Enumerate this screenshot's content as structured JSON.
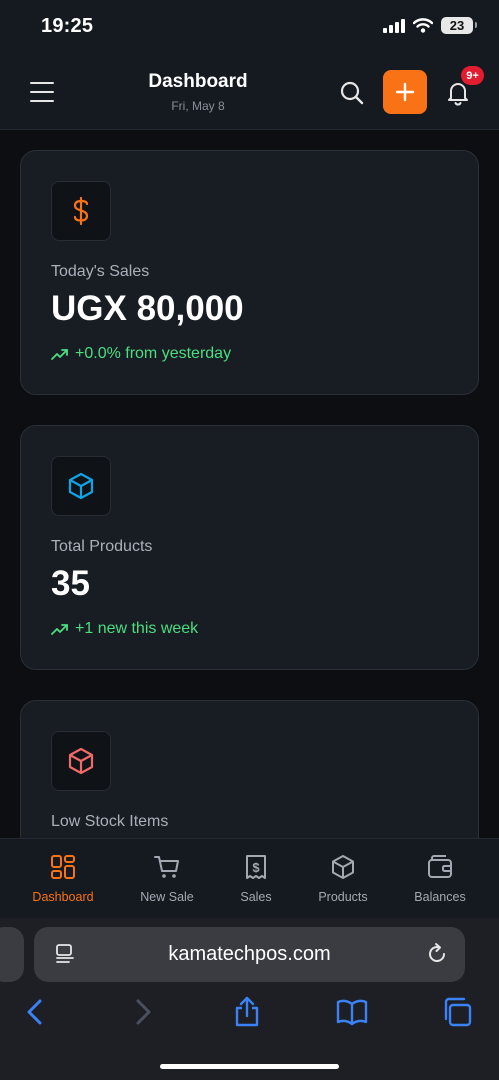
{
  "status": {
    "time": "19:25",
    "battery": "23"
  },
  "header": {
    "title": "Dashboard",
    "date": "Fri, May 8",
    "notif_count": "9+",
    "add_symbol": "+"
  },
  "cards": [
    {
      "label": "Today's Sales",
      "value": "UGX 80,000",
      "trend": "+0.0% from yesterday",
      "icon": "dollar-icon",
      "icon_color": "#f97316"
    },
    {
      "label": "Total Products",
      "value": "35",
      "trend": "+1 new this week",
      "icon": "box-icon",
      "icon_color": "#0ea5e9"
    },
    {
      "label": "Low Stock Items",
      "icon": "box-icon",
      "icon_color": "#f16a6a"
    }
  ],
  "nav": {
    "items": [
      {
        "label": "Dashboard",
        "icon": "grid-icon",
        "active": true
      },
      {
        "label": "New Sale",
        "icon": "cart-icon"
      },
      {
        "label": "Sales",
        "icon": "receipt-icon"
      },
      {
        "label": "Products",
        "icon": "box-icon"
      },
      {
        "label": "Balances",
        "icon": "wallet-icon"
      }
    ]
  },
  "browser": {
    "url": "kamatechpos.com"
  },
  "colors": {
    "accent": "#f97316",
    "positive": "#4ade80",
    "badge": "#e11d2f",
    "browser_blue": "#3b82f6"
  }
}
